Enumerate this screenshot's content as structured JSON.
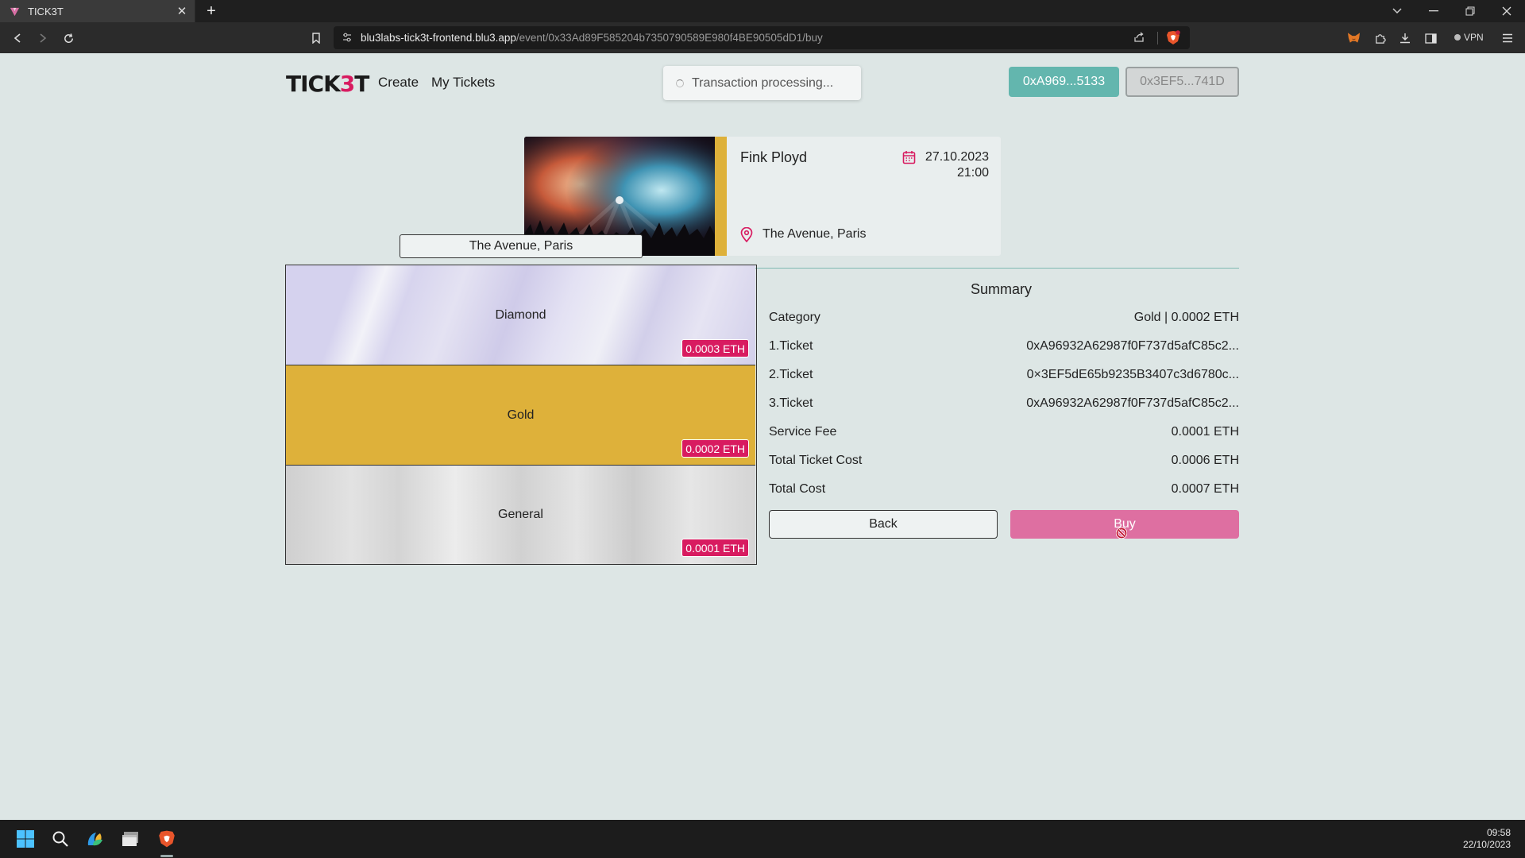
{
  "browser": {
    "tab_title": "TICK3T",
    "url_host": "blu3labs-tick3t-frontend.blu3.app",
    "url_path": "/event/0x33Ad89F585204b7350790589E980f4BE90505dD1/buy",
    "vpn_label": "VPN"
  },
  "header": {
    "logo_prefix": "TICK",
    "logo_accent": "3",
    "logo_suffix": "T",
    "nav_create": "Create",
    "nav_my_tickets": "My Tickets",
    "toast": "Transaction processing...",
    "wallet_primary": "0xA969...5133",
    "wallet_secondary": "0x3EF5...741D"
  },
  "event": {
    "name": "Fink Ployd",
    "date": "27.10.2023",
    "time": "21:00",
    "venue": "The Avenue, Paris"
  },
  "seatmap": {
    "venue_label": "The Avenue, Paris",
    "sections": [
      {
        "name": "Diamond",
        "price": "0.0003 ETH"
      },
      {
        "name": "Gold",
        "price": "0.0002 ETH"
      },
      {
        "name": "General",
        "price": "0.0001 ETH"
      }
    ]
  },
  "summary": {
    "title": "Summary",
    "rows": [
      {
        "label": "Category",
        "value": "Gold | 0.0002 ETH"
      },
      {
        "label": "1.Ticket",
        "value": "0xA96932A62987f0F737d5afC85c2..."
      },
      {
        "label": "2.Ticket",
        "value": "0×3EF5dE65b9235B3407c3d6780c..."
      },
      {
        "label": "3.Ticket",
        "value": "0xA96932A62987f0F737d5afC85c2..."
      },
      {
        "label": "Service Fee",
        "value": "0.0001 ETH"
      },
      {
        "label": "Total Ticket Cost",
        "value": "0.0006 ETH"
      },
      {
        "label": "Total Cost",
        "value": "0.0007 ETH"
      }
    ],
    "back_label": "Back",
    "buy_label": "Buy"
  },
  "taskbar": {
    "time": "09:58",
    "date": "22/10/2023"
  },
  "colors": {
    "brand_pink": "#d81b60",
    "accent_teal": "#63b6ae",
    "gold": "#deb13a",
    "page_bg": "#dde6e5"
  }
}
